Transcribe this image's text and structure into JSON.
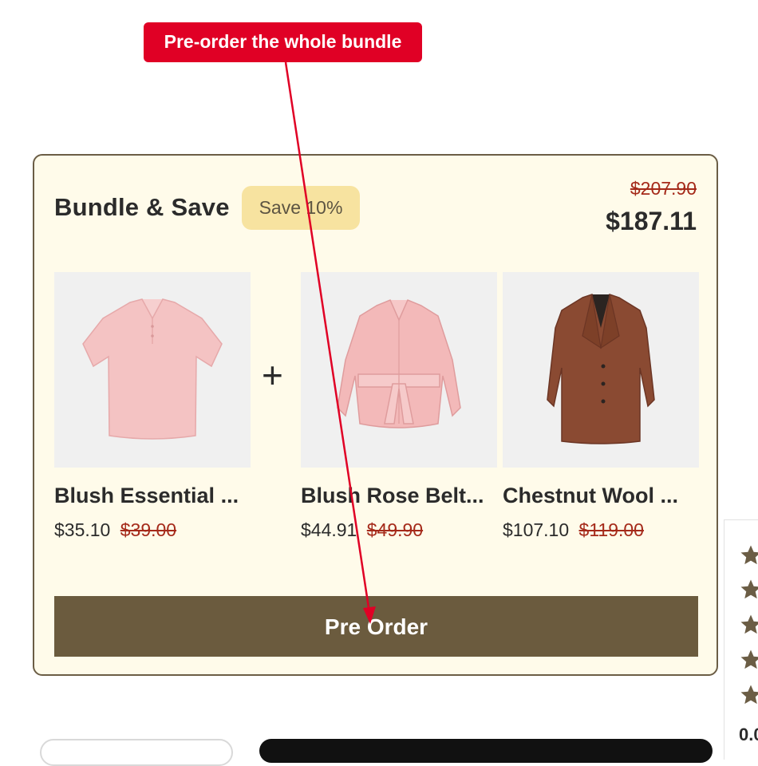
{
  "annotation": {
    "label": "Pre-order the whole bundle",
    "color": "#e00025"
  },
  "bundle": {
    "title": "Bundle & Save",
    "badge": "Save 10%",
    "original_total": "$207.90",
    "total": "$187.11",
    "plus_symbol": "+",
    "cta_label": "Pre Order",
    "products": [
      {
        "name": "Blush Essential ...",
        "sale_price": "$35.10",
        "original_price": "$39.00",
        "image": "pink-polo-shirt"
      },
      {
        "name": "Blush Rose Belt...",
        "sale_price": "$44.91",
        "original_price": "$49.90",
        "image": "pink-belted-shirt"
      },
      {
        "name": "Chestnut Wool ...",
        "sale_price": "$107.10",
        "original_price": "$119.00",
        "image": "brown-wool-coat"
      }
    ]
  },
  "reviews": {
    "count_text": "0.0",
    "star_icon": "star-icon"
  },
  "colors": {
    "card_bg": "#fffbea",
    "card_border": "#6b5d45",
    "badge_bg": "#f7e3a0",
    "button_bg": "#6b5b3e",
    "strike_price": "#a52a1a",
    "star": "#6b5d45"
  }
}
